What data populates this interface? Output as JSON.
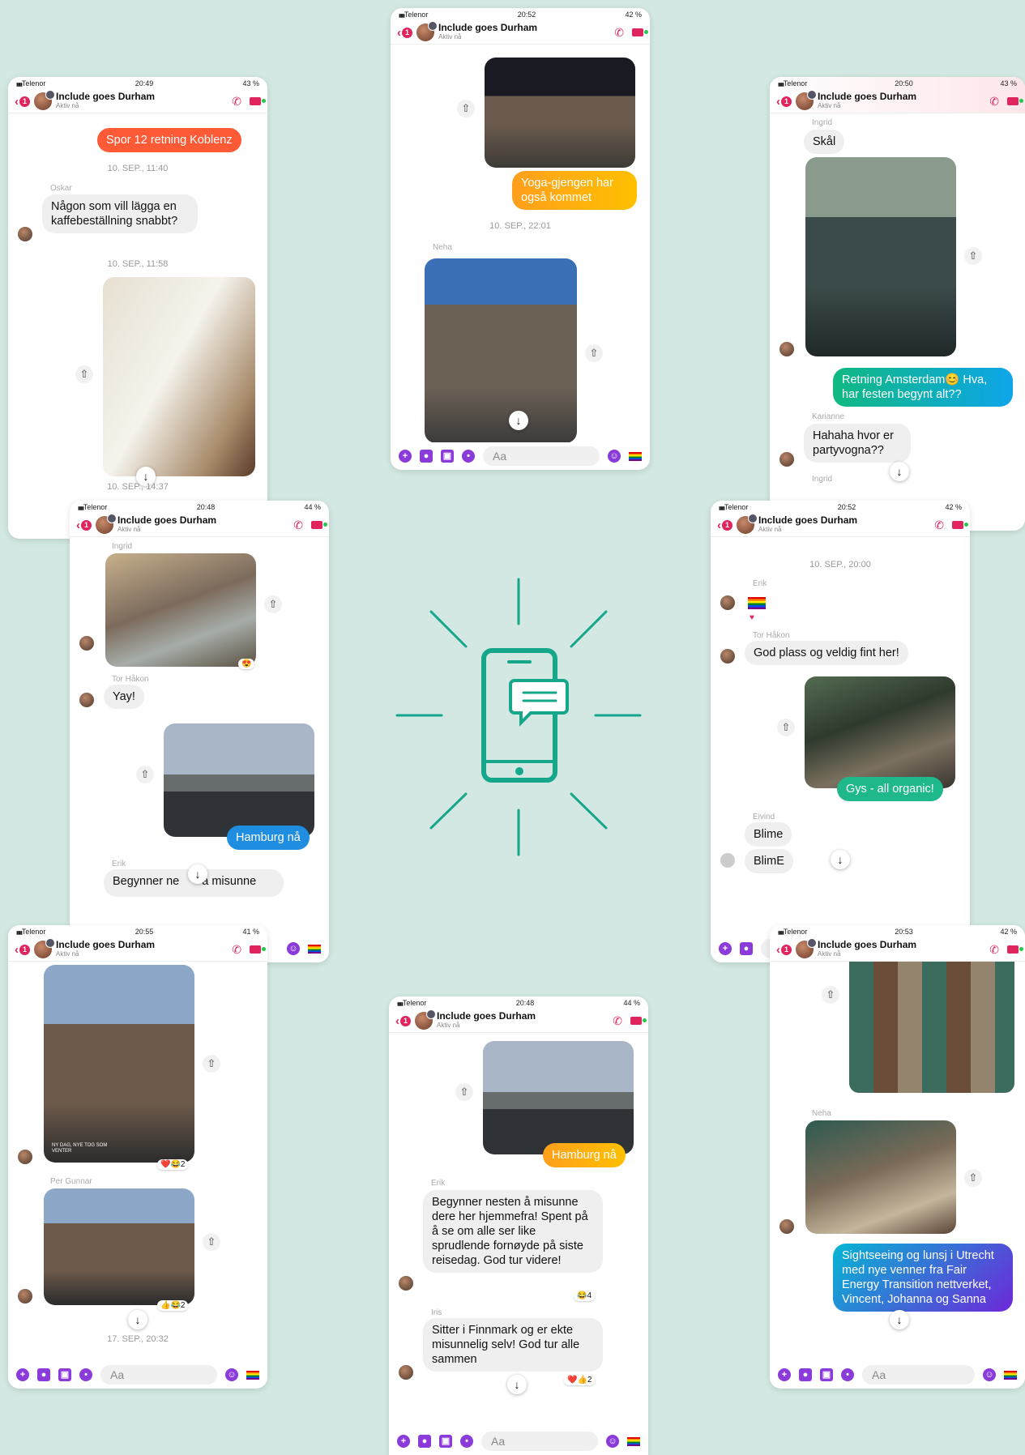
{
  "colors": {
    "background": "#d3e8e2",
    "accent": "#e0245e",
    "icon_teal": "#16a68a"
  },
  "common": {
    "carrier": "Telenor",
    "title": "Include goes Durham",
    "subtitle": "Aktiv nå",
    "unread": "1",
    "input_placeholder": "Aa"
  },
  "p1": {
    "time": "20:49",
    "battery": "43 %",
    "banner": "Spor 12 retning Koblenz",
    "ts1": "10. SEP., 11:40",
    "sender1": "Oskar",
    "msg1": "Någon som vill lägga en kaffebeställning snabbt?",
    "ts2": "10. SEP., 11:58",
    "ts3": "10. SEP., 14:37"
  },
  "p2": {
    "time": "20:52",
    "battery": "42 %",
    "msg1": "Yoga-gjengen har også kommet",
    "ts1": "10. SEP., 22:01",
    "sender1": "Neha"
  },
  "p3": {
    "time": "20:50",
    "battery": "43 %",
    "sender1": "Ingrid",
    "msg1": "Skål",
    "msg2": "Retning Amsterdam😊 Hva, har festen begynt alt??",
    "sender2": "Karianne",
    "msg3": "Hahaha hvor er partyvogna??",
    "sender3": "Ingrid"
  },
  "p4": {
    "time": "20:48",
    "battery": "44 %",
    "sender1": "Ingrid",
    "sender2": "Tor Håkon",
    "msg1": "Yay!",
    "msg2": "Hamburg nå",
    "sender3": "Erik",
    "msg3": "Begynner ne",
    "msg3b": "å misunne"
  },
  "p5": {
    "time": "20:52",
    "battery": "42 %",
    "ts1": "10. SEP., 20:00",
    "sender1": "Erik",
    "sender2": "Tor Håkon",
    "msg1": "God plass og veldig fint her!",
    "msg2": "Gys - all organic!",
    "sender3": "Eivind",
    "msg3": "Blime",
    "msg4": "BlimE"
  },
  "p6": {
    "time": "20:55",
    "battery": "41 %",
    "sign": "NY DAG, NYE TOG SOM VENTER",
    "react1": "❤️😂2",
    "sender1": "Per Gunnar",
    "react2": "👍😂2",
    "ts1": "17. SEP., 20:32"
  },
  "p7": {
    "time": "20:48",
    "battery": "44 %",
    "msg1": "Hamburg nå",
    "sender1": "Erik",
    "msg2": "Begynner nesten å misunne dere her hjemmefra! Spent på å se om alle ser like sprudlende fornøyde på siste reisedag. God tur videre!",
    "react1": "😂4",
    "sender2": "Iris",
    "msg3": "Sitter i Finnmark og er ekte misunnelig selv! God tur alle sammen",
    "react2": "❤️👍2"
  },
  "p8": {
    "time": "20:53",
    "battery": "42 %",
    "sender1": "Neha",
    "msg1": "Sightseeing og lunsj i Utrecht med nye venner fra Fair Energy Transition nettverket, Vincent, Johanna og Sanna"
  }
}
